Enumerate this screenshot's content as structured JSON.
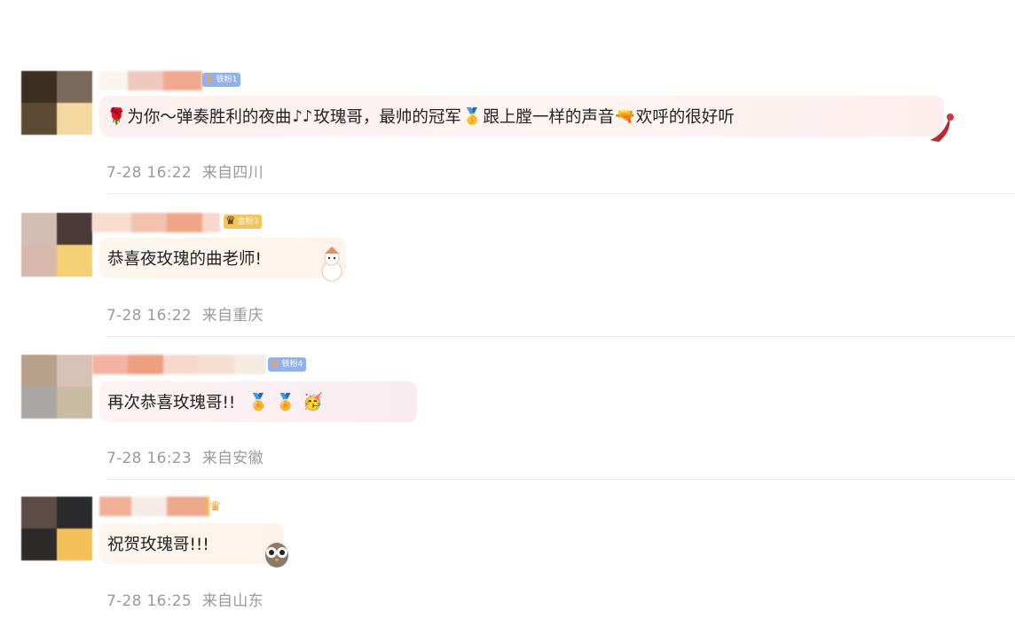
{
  "comments": [
    {
      "badge": "铁粉1",
      "text_parts": [
        "为你～弹奏胜利的夜曲",
        "玫瑰哥，最帅的冠军",
        "跟上膛一样的声音",
        "欢呼的很好听"
      ],
      "emojis": [
        "rose-icon",
        "music-notes-icon",
        "gold-medal-icon",
        "water-gun-icon"
      ],
      "time": "7-28 16:22",
      "location": "来自四川",
      "colors": {
        "badge": "#8fb2ef",
        "bubble": "#fdf2f2"
      }
    },
    {
      "badge": "金粉3",
      "text": "恭喜夜玫瑰的曲老师!",
      "time": "7-28 16:22",
      "location": "来自重庆",
      "colors": {
        "badge": "#f6c25a",
        "bubble": "#fdf6ee"
      }
    },
    {
      "badge": "铁粉4",
      "text": "再次恭喜玫瑰哥!!",
      "emojis": [
        "medal-face-icon",
        "medal-face-icon",
        "party-face-icon"
      ],
      "time": "7-28 16:23",
      "location": "来自安徽",
      "colors": {
        "badge": "#8fb2ef",
        "bubble": "#fbf1f4"
      }
    },
    {
      "badge": "",
      "text": "祝贺玫瑰哥!!!",
      "time": "7-28 16:25",
      "location": "来自山东",
      "colors": {
        "badge": "#f6c25a",
        "bubble": "#fdf6ee"
      }
    }
  ]
}
